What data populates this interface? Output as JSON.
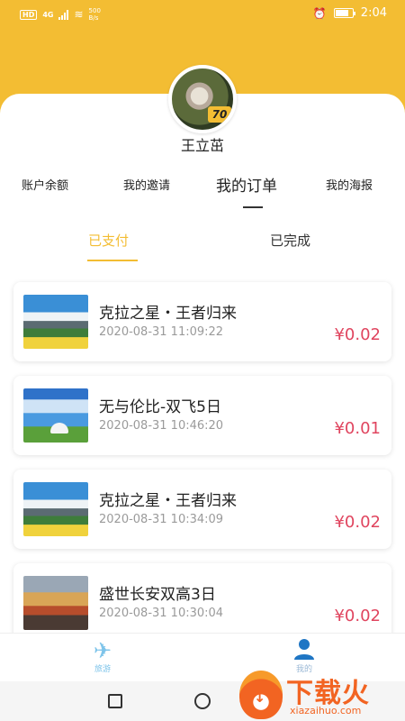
{
  "status_bar": {
    "hd": "HD",
    "network": "4G",
    "net_speed_value": "500",
    "net_speed_unit": "B/s",
    "time": "2:04",
    "battery_level": 0.8
  },
  "profile": {
    "avatar_badge": "70",
    "username": "王立茁"
  },
  "menu": {
    "items": [
      "账户余额",
      "我的邀请",
      "我的订单",
      "我的海报"
    ],
    "active_index": 2
  },
  "subtabs": {
    "items": [
      "已支付",
      "已完成"
    ],
    "active_index": 0
  },
  "orders": [
    {
      "title": "克拉之星・王者归来",
      "time": "2020-08-31 11:09:22",
      "price": "¥0.02",
      "image": "mountain"
    },
    {
      "title": "无与伦比-双飞5日",
      "time": "2020-08-31 10:46:20",
      "price": "¥0.01",
      "image": "sky"
    },
    {
      "title": "克拉之星・王者归来",
      "time": "2020-08-31 10:34:09",
      "price": "¥0.02",
      "image": "mountain"
    },
    {
      "title": "盛世长安双高3日",
      "time": "2020-08-31 10:30:04",
      "price": "¥0.02",
      "image": "city"
    }
  ],
  "tabbar": {
    "travel_label": "旅游",
    "me_label": "我的",
    "travel_icon": "plane-icon",
    "me_icon": "person-icon"
  },
  "watermark": {
    "cn": "下载火",
    "en": "xiazaihuo.com"
  },
  "colors": {
    "brand_yellow": "#f3bd33",
    "price_red": "#e0455f",
    "tab_blue": "#7ec4ea"
  }
}
